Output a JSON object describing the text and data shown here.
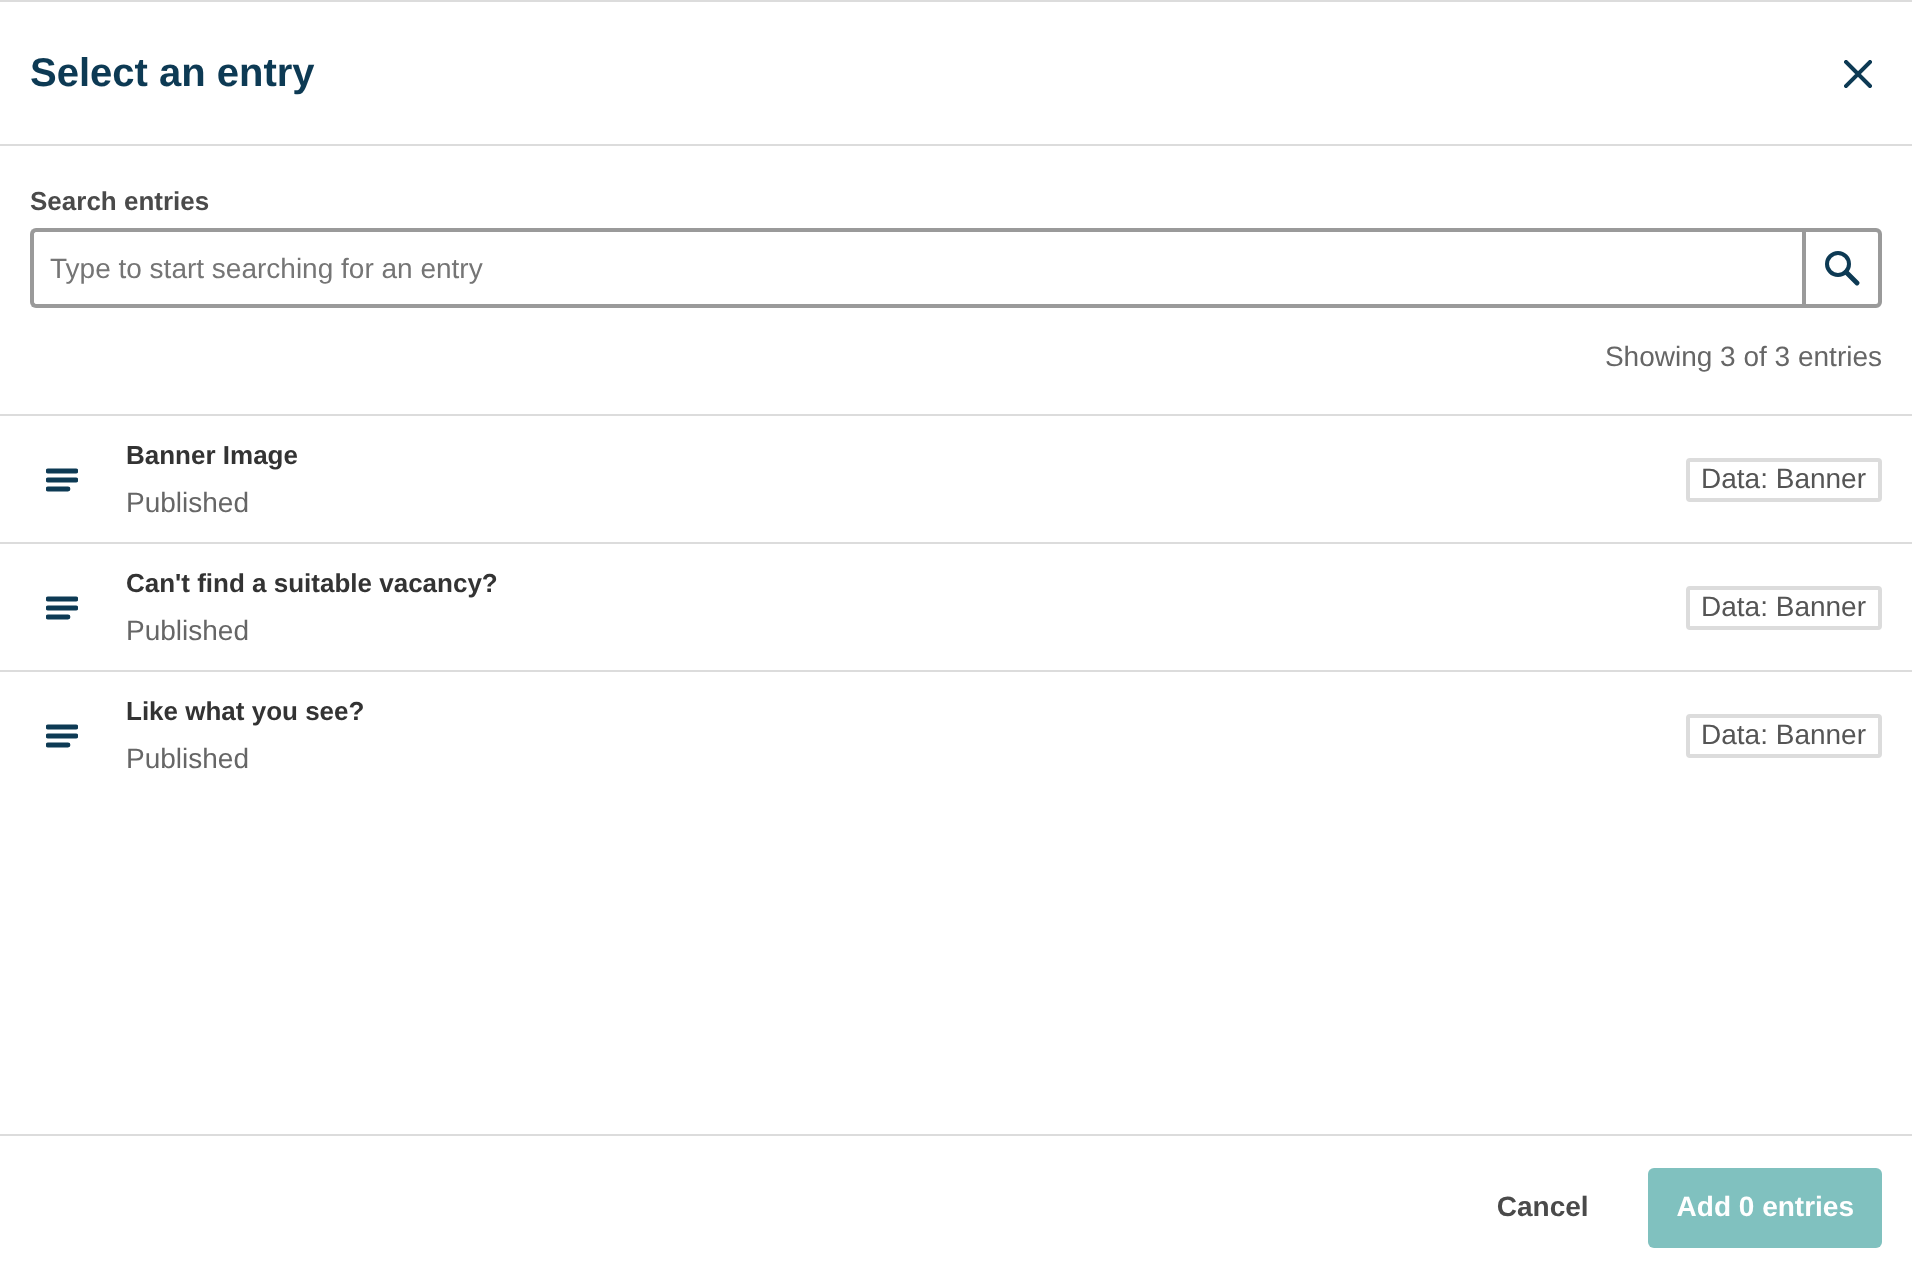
{
  "dialog": {
    "title": "Select an entry"
  },
  "search": {
    "label": "Search entries",
    "placeholder": "Type to start searching for an entry"
  },
  "result_count": "Showing 3 of 3 entries",
  "entries": [
    {
      "title": "Banner Image",
      "status": "Published",
      "tag": "Data: Banner"
    },
    {
      "title": "Can't find a suitable vacancy?",
      "status": "Published",
      "tag": "Data: Banner"
    },
    {
      "title": "Like what you see?",
      "status": "Published",
      "tag": "Data: Banner"
    }
  ],
  "footer": {
    "buttons": [
      {
        "label": "Cancel",
        "kind": "secondary",
        "disabled": false
      },
      {
        "label": "Add 0 entries",
        "kind": "primary",
        "disabled": true
      }
    ]
  }
}
